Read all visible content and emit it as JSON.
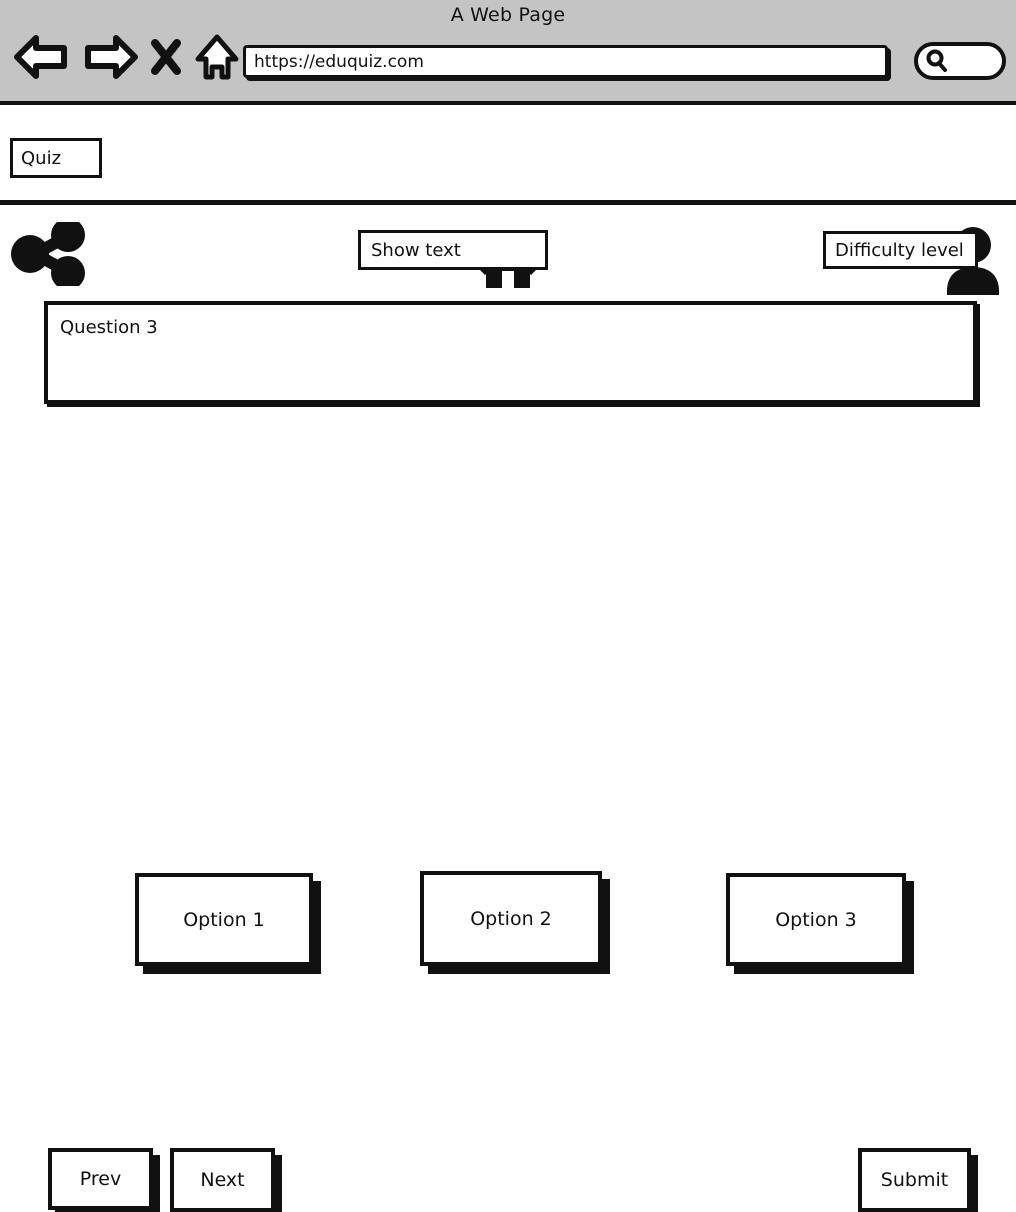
{
  "browser": {
    "title": "A Web Page",
    "url": "https://eduquiz.com",
    "chrome_color": "#c4c4c4",
    "ink_color": "#111111",
    "controls": [
      {
        "name": "back-icon",
        "label": "Back"
      },
      {
        "name": "forward-icon",
        "label": "Forward"
      },
      {
        "name": "close-icon",
        "label": "Close"
      },
      {
        "name": "home-icon",
        "label": "Home"
      }
    ],
    "search": {
      "icon": "search-icon",
      "value": "",
      "placeholder": ""
    }
  },
  "app_header": {
    "brand_label": "Quiz",
    "home_icon": "home-icon",
    "avatar_icon": "user-avatar-icon"
  },
  "toolbar": {
    "share_icon": "share-icon",
    "show_text_label": "Show text",
    "difficulty_label": "Difficulty level"
  },
  "question": {
    "text": "Question 3"
  },
  "options": [
    {
      "label": "Option 1"
    },
    {
      "label": "Option 2"
    },
    {
      "label": "Option 3"
    }
  ],
  "footer": {
    "prev_label": "Prev",
    "next_label": "Next",
    "submit_label": "Submit"
  }
}
